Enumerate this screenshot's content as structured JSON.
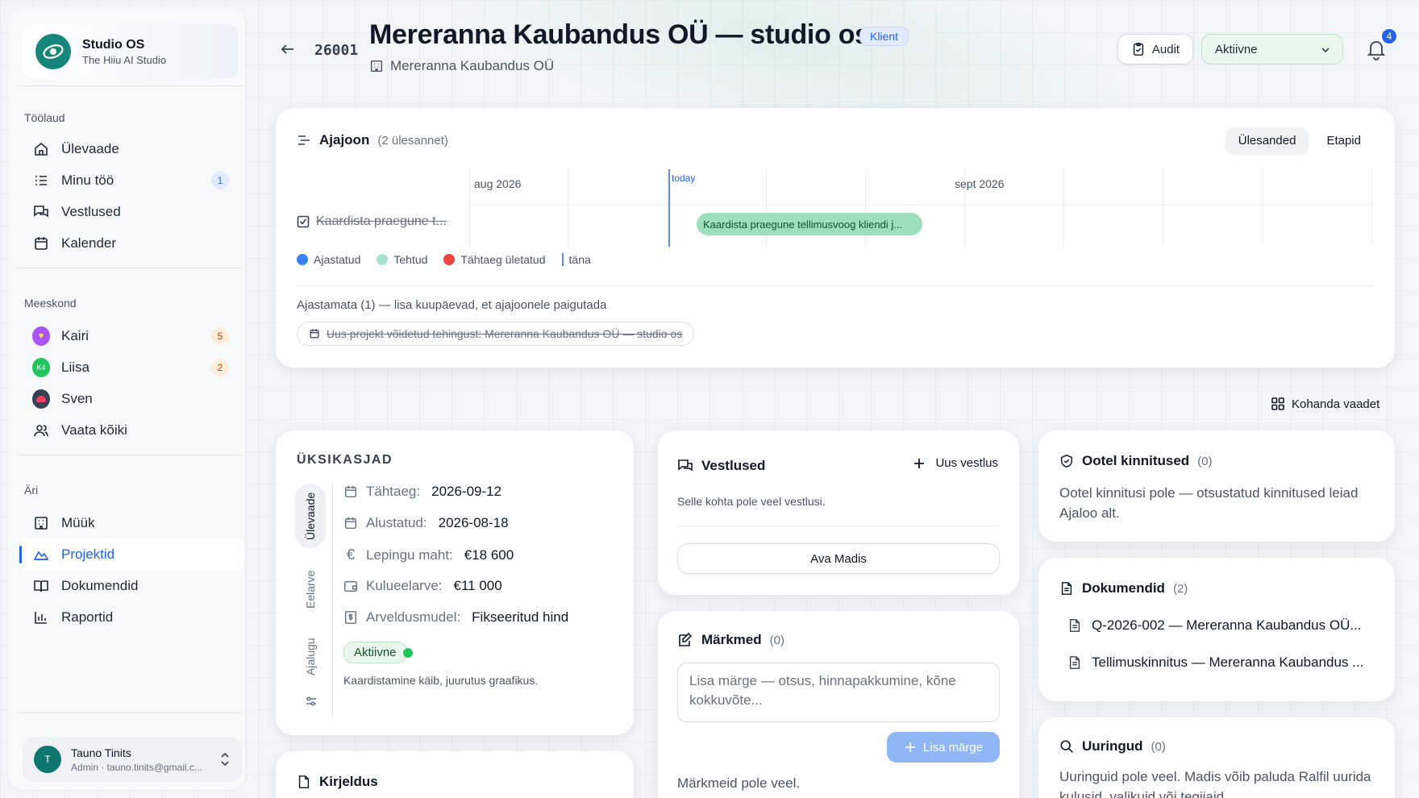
{
  "brand": {
    "name": "Studio OS",
    "tagline": "The Hiiu AI Studio"
  },
  "sidebar": {
    "workspace_label": "Töölaud",
    "workspace_items": [
      {
        "label": "Ülevaade",
        "icon": "home-icon"
      },
      {
        "label": "Minu töö",
        "icon": "list-icon",
        "count": "1"
      },
      {
        "label": "Vestlused",
        "icon": "chat-icon"
      },
      {
        "label": "Kalender",
        "icon": "calendar-icon"
      }
    ],
    "team_label": "Meeskond",
    "team_items": [
      {
        "label": "Kairi",
        "count": "5",
        "color": "#a855f7"
      },
      {
        "label": "Liisa",
        "count": "2",
        "color": "#22c55e"
      },
      {
        "label": "Sven",
        "color": "#e11d48"
      },
      {
        "label": "Vaata kõiki",
        "icon": "users-icon"
      }
    ],
    "business_label": "Äri",
    "business_items": [
      {
        "label": "Müük",
        "icon": "building-icon"
      },
      {
        "label": "Projektid",
        "icon": "briefcase-icon",
        "active": true
      },
      {
        "label": "Dokumendid",
        "icon": "book-icon"
      },
      {
        "label": "Raportid",
        "icon": "chart-icon"
      }
    ],
    "user": {
      "initial": "T",
      "name": "Tauno Tinits",
      "meta": "Admin · tauno.tinits@gmail.c..."
    }
  },
  "header": {
    "project_id": "26001",
    "title": "Mereranna Kaubandus OÜ — studio os",
    "tag": "Klient",
    "subtitle": "Mereranna Kaubandus OÜ",
    "audit_label": "Audit",
    "status_value": "Aktiivne",
    "notification_count": "4"
  },
  "timeline": {
    "title": "Ajajoon",
    "count": "(2 ülesannet)",
    "toggle": [
      "Ülesanded",
      "Etapid"
    ],
    "months": [
      "aug 2026",
      "sept 2026"
    ],
    "today_label": "today",
    "task_label": "Kaardista praegune t...",
    "bar_label": "Kaardista praegune tellimusvoog kliendi j...",
    "legend": [
      "Ajastatud",
      "Tehtud",
      "Tähtaeg ületatud",
      "täna"
    ],
    "unscheduled_label": "Ajastamata (1) — lisa kuupäevad, et ajajoonele paigutada",
    "unscheduled_item": "Uus projekt võidetud tehingust: Mereranna Kaubandus OÜ — studio os"
  },
  "customize_label": "Kohanda vaadet",
  "details": {
    "title": "ÜKSIKASJAD",
    "tabs": [
      "Ülevaade",
      "Eelarve",
      "Ajalugu"
    ],
    "fields": [
      {
        "label": "Tähtaeg:",
        "value": "2026-09-12",
        "icon": "calendar-icon"
      },
      {
        "label": "Alustatud:",
        "value": "2026-08-18",
        "icon": "calendar-icon"
      },
      {
        "label": "Lepingu maht:",
        "value": "€18 600",
        "icon": "euro-icon"
      },
      {
        "label": "Kulueelarve:",
        "value": "€11 000",
        "icon": "wallet-icon"
      },
      {
        "label": "Arveldusmudel:",
        "value": "Fikseeritud hind",
        "icon": "invoice-icon"
      }
    ],
    "status": "Aktiivne",
    "note": "Kaardistamine käib, juurutus graafikus."
  },
  "description": {
    "title": "Kirjeldus"
  },
  "chats": {
    "title": "Vestlused",
    "new_label": "Uus vestlus",
    "empty": "Selle kohta pole veel vestlusi.",
    "open_label": "Ava Madis"
  },
  "notes": {
    "title": "Märkmed",
    "count": "(0)",
    "placeholder": "Lisa märge — otsus, hinnapakkumine, kõne kokkuvõte...",
    "add_label": "Lisa märge",
    "empty": "Märkmeid pole veel."
  },
  "confirmations": {
    "title": "Ootel kinnitused",
    "count": "(0)",
    "text": "Ootel kinnitusi pole — otsustatud kinnitused leiad Ajaloo alt."
  },
  "documents": {
    "title": "Dokumendid",
    "count": "(2)",
    "items": [
      "Q-2026-002 — Mereranna Kaubandus OÜ...",
      "Tellimuskinnitus — Mereranna Kaubandus ..."
    ]
  },
  "research": {
    "title": "Uuringud",
    "count": "(0)",
    "text": "Uuringuid pole veel. Madis võib paluda Ralfil uurida kulusid, valikuid või tegijaid."
  },
  "colors": {
    "accent": "#2563eb",
    "scheduled": "#3b82f6",
    "done": "#a7e3d0",
    "overdue": "#ef4444",
    "timeline_bar": "#9ee0bd"
  }
}
